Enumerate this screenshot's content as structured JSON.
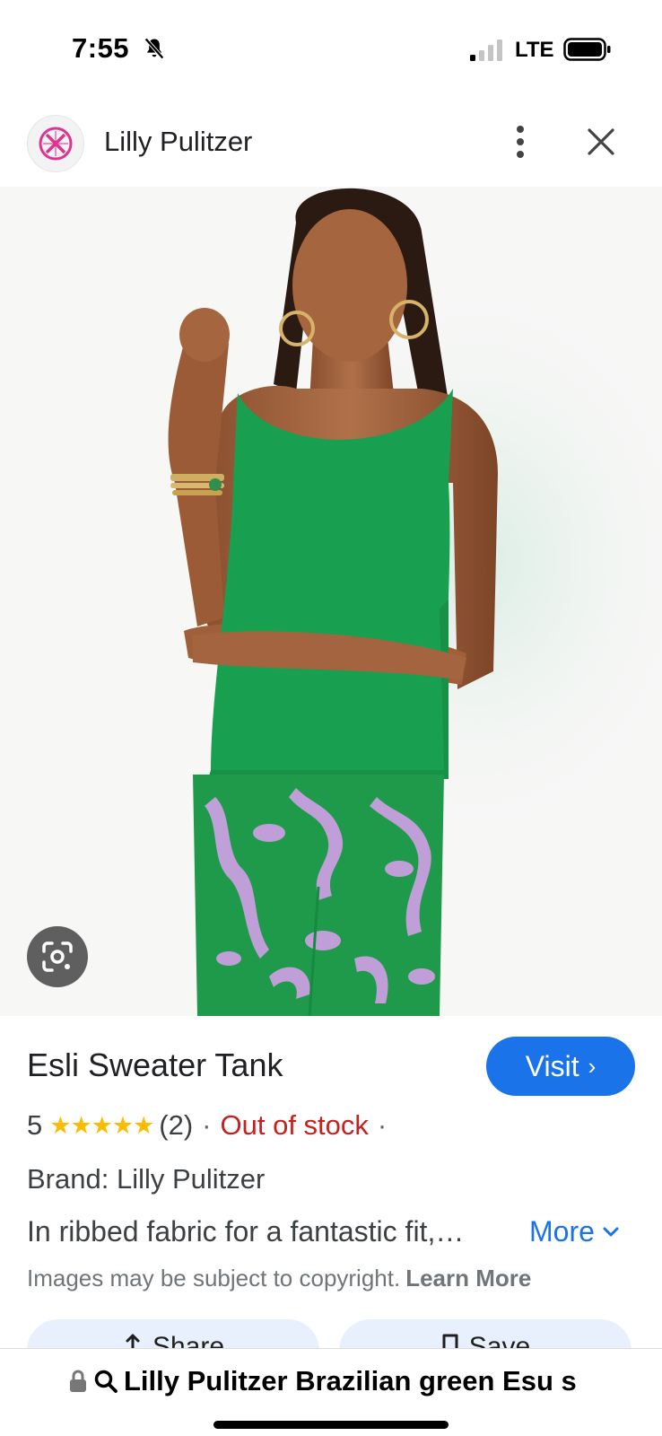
{
  "status_bar": {
    "time": "7:55",
    "network": "LTE"
  },
  "header": {
    "site_name": "Lilly Pulitzer",
    "logo_icon": "lilly-pulitzer-logo",
    "brand_color": "#e0338f"
  },
  "product": {
    "title": "Esli Sweater Tank",
    "visit_label": "Visit",
    "rating_value": "5",
    "rating_stars": 5,
    "rating_count": "(2)",
    "availability": "Out of stock",
    "brand": "Brand: Lilly Pulitzer",
    "description": "In ribbed fabric for a fantastic fit,…",
    "more_label": "More",
    "copyright": "Images may be subject to copyright.",
    "learn_more": "Learn More"
  },
  "actions": {
    "share_label": "Share",
    "save_label": "Save"
  },
  "address_bar": {
    "url_text": "Lilly Pulitzer Brazilian green Esu s"
  },
  "colors": {
    "accent": "#1a73e8",
    "out_of_stock": "#c5221f",
    "stars": "#fbbc04",
    "top_green": "#18a050",
    "print_lilac": "#c9a0e0"
  }
}
